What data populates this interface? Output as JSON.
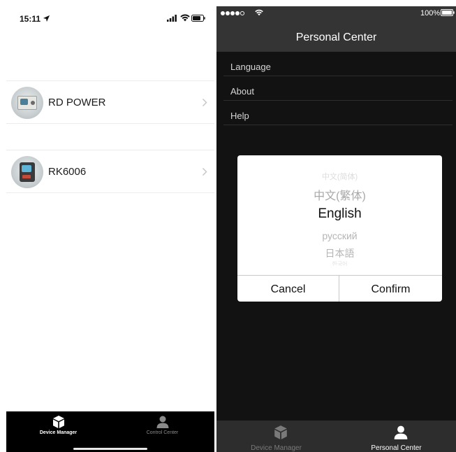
{
  "left_screen": {
    "status_bar": {
      "time": "15:11"
    },
    "devices": [
      {
        "name": "RD POWER"
      },
      {
        "name": "RK6006"
      }
    ],
    "tab_bar": [
      {
        "label": "Device Manager",
        "icon": "device-box-icon",
        "active": true
      },
      {
        "label": "Control Center",
        "icon": "person-icon",
        "active": false
      }
    ]
  },
  "right_screen": {
    "status_bar": {
      "battery_percent": "100%"
    },
    "nav_title": "Personal Center",
    "menu": [
      {
        "label": "Language"
      },
      {
        "label": "About"
      },
      {
        "label": "Help"
      }
    ],
    "language_dialog": {
      "options": [
        "中文(简体)",
        "中文(繁体)",
        "English",
        "русский",
        "日本語",
        "한국어"
      ],
      "selected": "English",
      "cancel_label": "Cancel",
      "confirm_label": "Confirm"
    },
    "tab_bar": [
      {
        "label": "Device Manager",
        "icon": "device-box-icon",
        "active": false
      },
      {
        "label": "Personal Center",
        "icon": "person-icon",
        "active": true
      }
    ]
  },
  "colors": {
    "tab_bar_left": "#000000",
    "header_dark": "#343434",
    "background_dark": "#121212",
    "active_tab_text": "#ffffff",
    "inactive_tab_text": "#8a8a8a"
  }
}
